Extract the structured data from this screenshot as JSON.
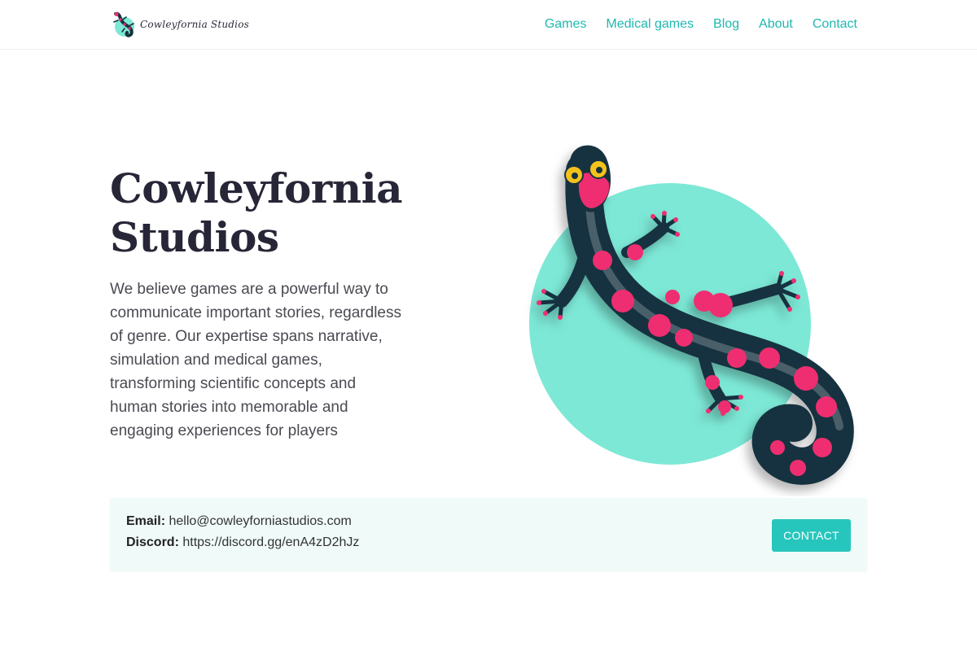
{
  "header": {
    "logo_text": "Cowleyfornia Studios",
    "nav": [
      "Games",
      "Medical games",
      "Blog",
      "About",
      "Contact"
    ]
  },
  "hero": {
    "title_line1": "Cowleyfornia",
    "title_line2": "Studios",
    "description": "We believe games are a powerful way to communicate important stories, regardless of genre. Our expertise spans narrative, simulation and medical games, transforming scientific concepts and human stories into memorable and engaging experiences for players",
    "art_icon": "gecko-illustration"
  },
  "contact": {
    "email_label": "Email:",
    "email_value": "hello@cowleyforniastudios.com",
    "discord_label": "Discord:",
    "discord_value": "https://discord.gg/enA4zD2hJz",
    "button_label": "CONTACT"
  },
  "colors": {
    "accent": "#26c6bd",
    "nav_link": "#1fb8b0",
    "title": "#262637",
    "mint_circle": "#7de8d6",
    "gecko_body": "#17323f",
    "gecko_spots": "#ee2f6f",
    "contact_bg": "#f0faf9"
  }
}
